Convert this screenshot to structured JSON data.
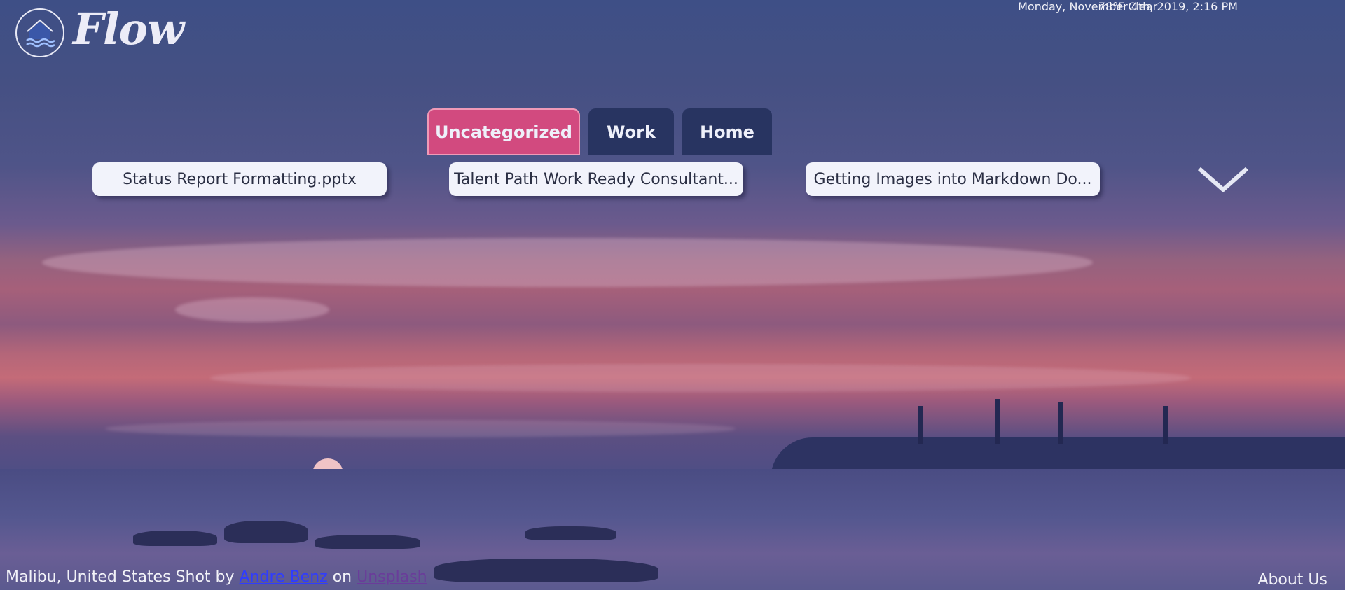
{
  "app": {
    "logo_text": "Flow",
    "logo_icon": "house-waves-icon"
  },
  "weather": {
    "summary": "78°F Clear",
    "datetime": "Monday, November 4th, 2019, 2:16 PM"
  },
  "tabs": [
    {
      "label": "Uncategorized",
      "active": true
    },
    {
      "label": "Work",
      "active": false
    },
    {
      "label": "Home",
      "active": false
    }
  ],
  "files": [
    {
      "name": "Status Report Formatting.pptx"
    },
    {
      "name": "Talent Path Work Ready Consultant..."
    },
    {
      "name": "Getting Images into Markdown Do..."
    }
  ],
  "expand_icon": "chevron-down-icon",
  "footer": {
    "location_text": "Malibu, United States Shot by",
    "author": "Andre Benz",
    "on_text": "on",
    "site": "Unsplash",
    "about": "About Us"
  },
  "colors": {
    "active_tab": "#d24a7f",
    "inactive_tab": "#283461",
    "card_bg": "#f2f3fb"
  }
}
